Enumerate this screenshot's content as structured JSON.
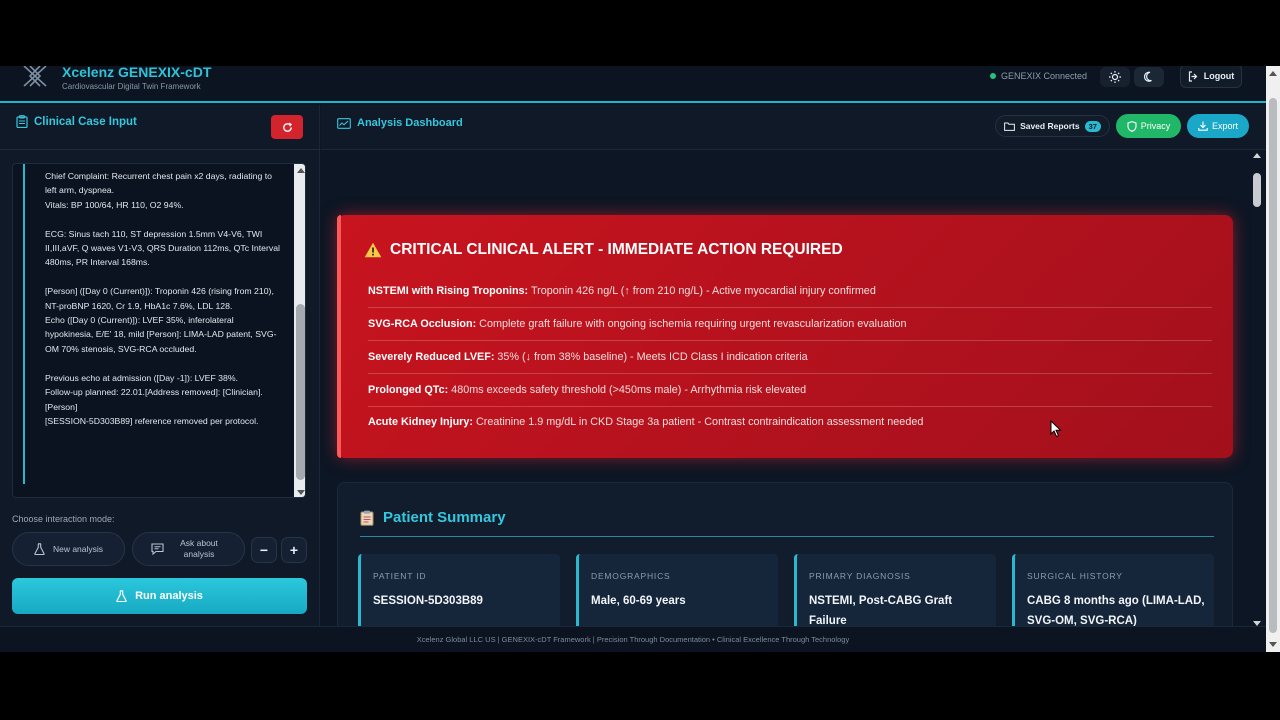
{
  "header": {
    "title": "Xcelenz GENEXIX-cDT",
    "subtitle": "Cardiovascular Digital Twin Framework",
    "connection_status": "GENEXIX Connected",
    "logout_label": "Logout"
  },
  "left_panel": {
    "title": "Clinical Case Input",
    "case_text": "Chief Complaint: Recurrent chest pain x2 days, radiating to left arm, dyspnea.\nVitals: BP 100/64, HR 110, O2 94%.\n\nECG: Sinus tach 110, ST depression 1.5mm V4-V6, TWI II,III,aVF, Q waves V1-V3, QRS Duration 112ms, QTc Interval 480ms, PR Interval 168ms.\n\n[Person] ([Day 0 (Current)]): Troponin 426 (rising from 210), NT-proBNP 1620, Cr 1.9, HbA1c 7.6%, LDL 128.\nEcho ([Day 0 (Current)]): LVEF 35%, inferolateral hypokinesia, E/E' 18, mild [Person]: LIMA-LAD patent, SVG-OM 70% stenosis, SVG-RCA occluded.\n\nPrevious echo at admission ([Day -1]): LVEF 38%.\nFollow-up planned: 22.01.[Address removed]: [Clinician]. [Person]\n[SESSION-5D303B89] reference removed per protocol.",
    "mode_label": "Choose interaction mode:",
    "mode_new": "New analysis",
    "mode_ask": "Ask about analysis",
    "minus_label": "−",
    "plus_label": "+",
    "run_label": "Run analysis"
  },
  "dashboard": {
    "title": "Analysis Dashboard",
    "saved_label": "Saved Reports",
    "saved_count": "37",
    "privacy_label": "Privacy",
    "export_label": "Export"
  },
  "alert": {
    "title": "CRITICAL CLINICAL ALERT - IMMEDIATE ACTION REQUIRED",
    "items": [
      {
        "label": "NSTEMI with Rising Troponins:",
        "text": " Troponin 426 ng/L (↑ from 210 ng/L) - Active myocardial injury confirmed"
      },
      {
        "label": "SVG-RCA Occlusion:",
        "text": " Complete graft failure with ongoing ischemia requiring urgent revascularization evaluation"
      },
      {
        "label": "Severely Reduced LVEF:",
        "text": " 35% (↓ from 38% baseline) - Meets ICD Class I indication criteria"
      },
      {
        "label": "Prolonged QTc:",
        "text": " 480ms exceeds safety threshold (>450ms male) - Arrhythmia risk elevated"
      },
      {
        "label": "Acute Kidney Injury:",
        "text": " Creatinine 1.9 mg/dL in CKD Stage 3a patient - Contrast contraindication assessment needed"
      }
    ]
  },
  "summary": {
    "title": "Patient Summary",
    "cards": [
      {
        "label": "PATIENT ID",
        "value": "SESSION-5D303B89"
      },
      {
        "label": "DEMOGRAPHICS",
        "value": "Male, 60-69 years"
      },
      {
        "label": "PRIMARY DIAGNOSIS",
        "value": "NSTEMI, Post-CABG Graft Failure"
      },
      {
        "label": "SURGICAL HISTORY",
        "value": "CABG 8 months ago (LIMA-LAD, SVG-OM, SVG-RCA)"
      }
    ]
  },
  "footer": {
    "text": "Xcelenz Global LLC US | GENEXIX-cDT Framework | Precision Through Documentation • Clinical Excellence Through Technology"
  },
  "colors": {
    "accent": "#2fc3d8",
    "alert": "#c8141f",
    "privacy": "#20b868",
    "run": "#1fb9d1"
  }
}
